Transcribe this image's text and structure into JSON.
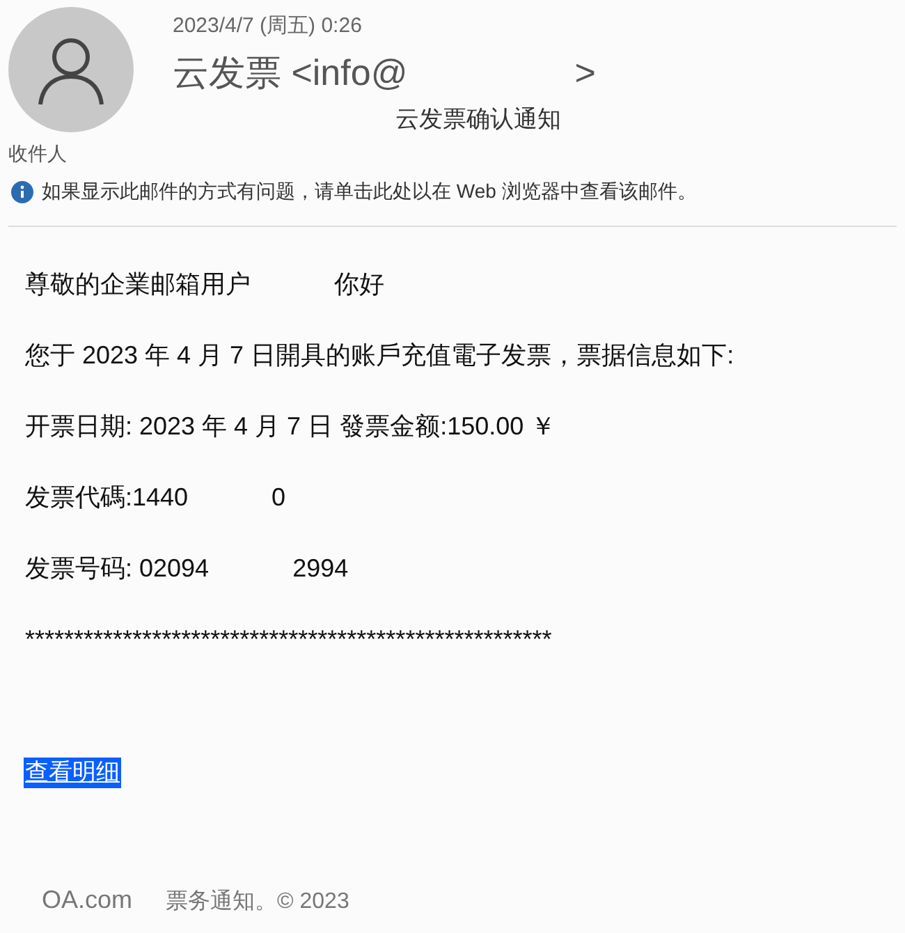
{
  "header": {
    "date": "2023/4/7 (周五) 0:26",
    "sender": "云发票 <info@",
    "sender_end": ">",
    "to_line": "云发票确认通知",
    "recipient_label": "收件人",
    "info_notice": "如果显示此邮件的方式有问题，请单击此处以在 Web 浏览器中查看该邮件。"
  },
  "body": {
    "paragraphs": [
      {
        "text": "尊敬的企業邮箱用户",
        "suffix": "你好"
      },
      {
        "text": "您于 2023 年 4 月 7 日開具的账戶充值電子发票，票据信息如下:"
      },
      {
        "text": "开票日期:  2023 年 4 月 7 日 發票金额:150.00 ￥"
      },
      {
        "text": "发票代碼:1440",
        "suffix": "0"
      },
      {
        "text": "发票号码: 02094",
        "suffix": "2994"
      },
      {
        "text": "******************************************************"
      }
    ],
    "link": "查看明细"
  },
  "footer": {
    "brand": "OA.com",
    "note": "票务通知。© 2023"
  }
}
